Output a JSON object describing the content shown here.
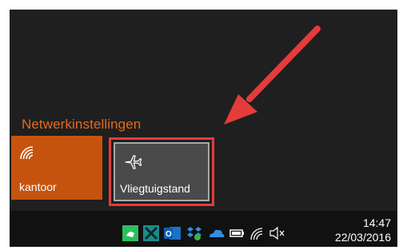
{
  "network_settings": {
    "label": "Netwerkinstellingen"
  },
  "tiles": [
    {
      "label": "kantoor",
      "icon": "wifi-icon",
      "color": "#c5530e"
    },
    {
      "label": "Vliegtuigstand",
      "icon": "airplane-icon",
      "color": "#4a4a4a"
    }
  ],
  "annotation": {
    "arrow_color": "#e53b3b",
    "highlight_color": "#e53b3b"
  },
  "taskbar": {
    "tray_icons": [
      "evernote-icon",
      "app-x-icon",
      "outlook-icon",
      "dropbox-icon",
      "onedrive-icon",
      "battery-icon",
      "wifi-icon",
      "volume-muted-icon"
    ],
    "time": "14:47",
    "date": "22/03/2016"
  }
}
